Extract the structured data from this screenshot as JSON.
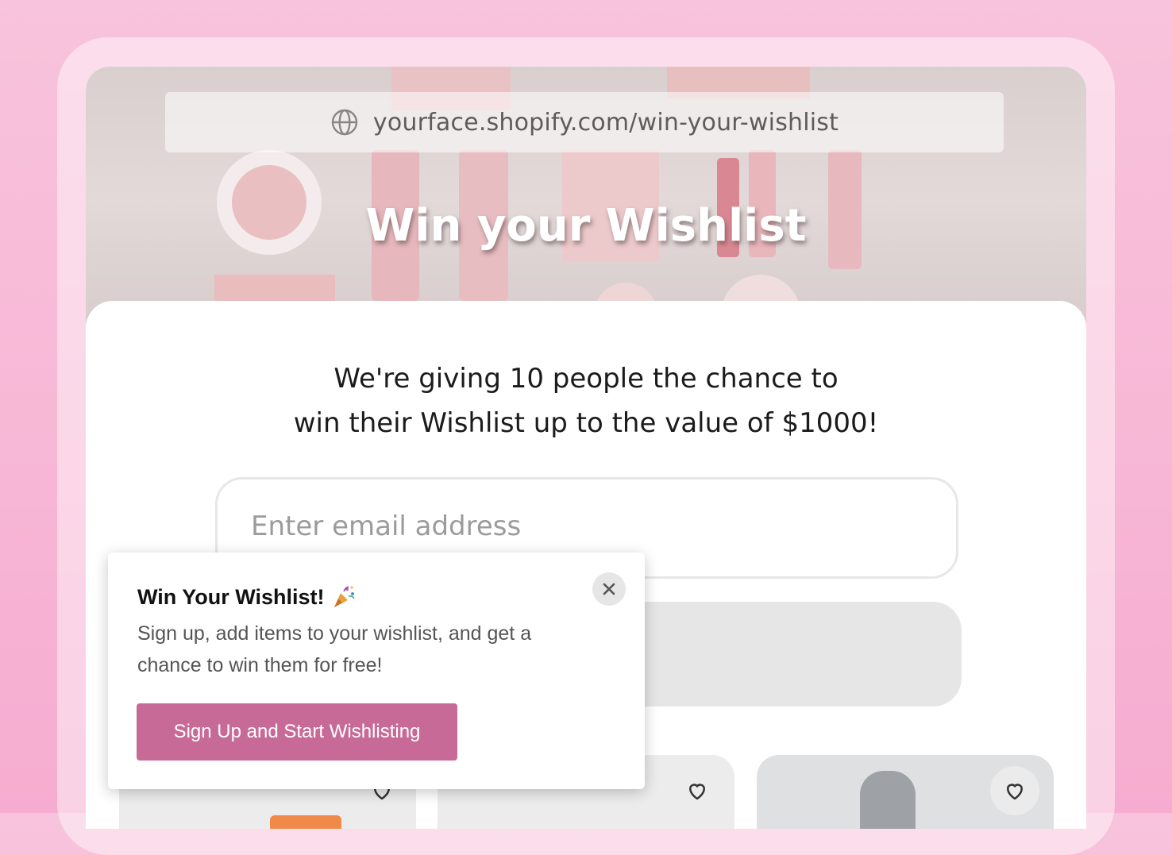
{
  "browser": {
    "url": "yourface.shopify.com/win-your-wishlist",
    "icon": "globe-icon"
  },
  "hero": {
    "title": "Win your Wishlist"
  },
  "main": {
    "intro_line1": "We're giving 10 people the chance to",
    "intro_line2": "win their Wishlist up to the value of $1000!",
    "email_placeholder": "Enter email address"
  },
  "popup": {
    "title": "Win Your Wishlist!",
    "title_emoji": "party-popper-icon",
    "body": "Sign up, add items to your wishlist, and get a chance to win them for free!",
    "cta_label": "Sign Up and Start Wishlisting",
    "cta_color": "#c86a97"
  },
  "colors": {
    "background": "#f7b6d5",
    "placeholder": "#9b9b9b"
  }
}
